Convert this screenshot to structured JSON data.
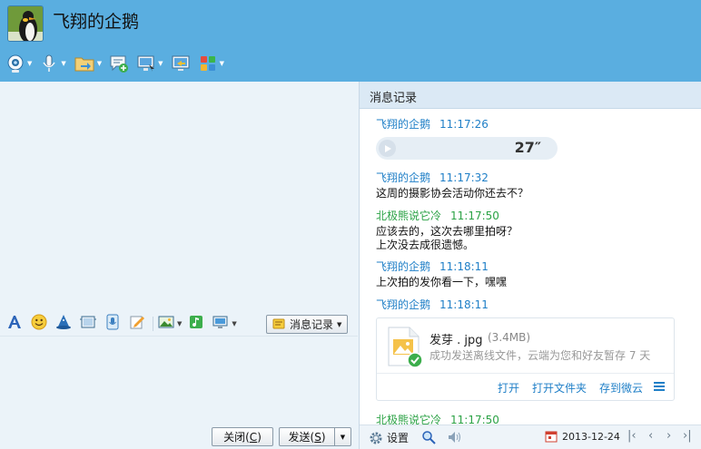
{
  "header": {
    "contact_name": "飞翔的企鹅",
    "toolbar_icons": [
      "webcam-icon",
      "microphone-icon",
      "file-transfer-icon",
      "new-discussion-icon",
      "remote-desktop-icon",
      "screen-share-icon",
      "apps-icon"
    ]
  },
  "format_bar": {
    "icons": [
      "font-icon",
      "emoji-icon",
      "magic-icon",
      "video-frame-icon",
      "voice-message-icon",
      "whiteboard-icon",
      "image-icon",
      "music-icon",
      "screenshot-icon"
    ],
    "history_button": "消息记录"
  },
  "buttons": {
    "close": "关闭(",
    "close_key": "C",
    "close_end": ")",
    "send": "发送(",
    "send_key": "S",
    "send_end": ")"
  },
  "history": {
    "title": "消息记录",
    "messages": [
      {
        "sender": "飞翔的企鹅",
        "time": "11:17:26"
      },
      {
        "sender": "飞翔的企鹅",
        "time": "11:17:32",
        "text": "这周的摄影协会活动你还去不？"
      },
      {
        "sender": "北极熊说它冷",
        "time": "11:17:50",
        "text": "应该去的，这次去哪里拍呀？",
        "text2": "上次没去成很遗憾。"
      },
      {
        "sender": "飞翔的企鹅",
        "time": "11:18:11",
        "text": "上次拍的发你看一下，嘿嘿"
      },
      {
        "sender": "飞翔的企鹅",
        "time": "11:18:11"
      },
      {
        "sender": "北极熊说它冷",
        "time": "11:17:50"
      }
    ],
    "voice": {
      "duration": "27″"
    },
    "file": {
      "name": "发芽 . jpg",
      "size": "(3.4MB)",
      "status": "成功发送离线文件，云端为您和好友暂存 7 天",
      "actions": [
        "打开",
        "打开文件夹",
        "存到微云"
      ]
    },
    "bottom": {
      "settings_label": "设置",
      "date": "2013-12-24"
    }
  },
  "colors": {
    "header_bg": "#5aaee0",
    "self_name": "#1f7fc7",
    "friend_name": "#2ba245"
  }
}
